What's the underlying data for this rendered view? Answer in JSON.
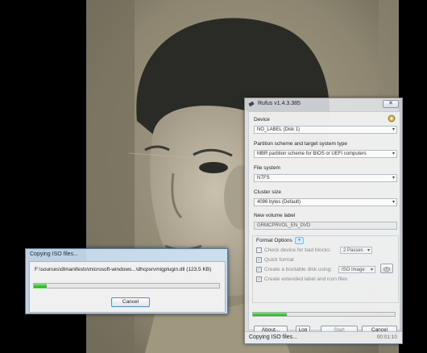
{
  "rufus": {
    "title": "Rufus v1.4.3.385",
    "close_label": "✕",
    "device_label": "Device",
    "device_value": "NO_LABEL (Disk 1)",
    "partition_label": "Partition scheme and target system type",
    "partition_value": "MBR partition scheme for BIOS or UEFI computers",
    "filesystem_label": "File system",
    "filesystem_value": "NTFS",
    "cluster_label": "Cluster size",
    "cluster_value": "4096 bytes (Default)",
    "volume_label": "New volume label",
    "volume_value": "GRMCPRVOL_EN_DVD",
    "format_options_label": "Format Options",
    "bad_blocks_label": "Check device for bad blocks:",
    "bad_blocks_passes": "2 Passes",
    "quick_format_label": "Quick format",
    "bootable_label": "Create a bootable disk using:",
    "bootable_type": "ISO Image",
    "extended_label": "Create extended label and icon files",
    "progress": 0.24,
    "about_label": "About...",
    "log_label": "Log",
    "start_label": "Start",
    "cancel_label": "Cancel",
    "status_text": "Copying ISO files...",
    "timer": "00:01:10"
  },
  "copy_dialog": {
    "title": "Copying ISO files...",
    "path": "F:\\sources\\dlmanifests\\microsoft-windows...\\dhcpsrvmigplugin.dll (123.5 KB)",
    "progress": 0.07,
    "cancel_label": "Cancel"
  },
  "colors": {
    "progress_green": "#12b312"
  }
}
